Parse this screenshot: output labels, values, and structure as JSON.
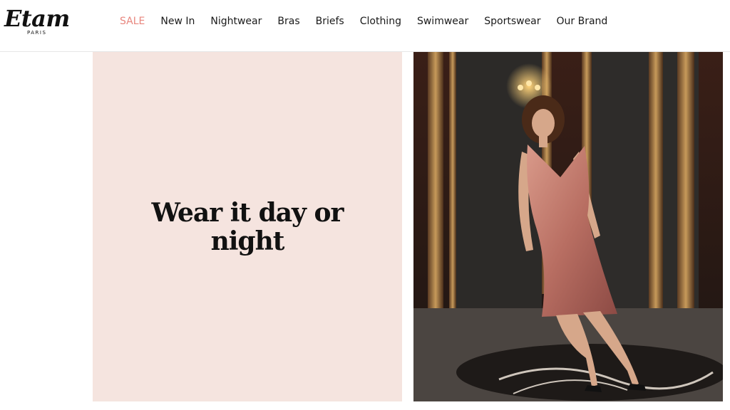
{
  "header": {
    "logo": {
      "word": "Etam",
      "sub": "PARIS"
    },
    "nav": [
      {
        "label": "SALE",
        "highlight": true
      },
      {
        "label": "New In"
      },
      {
        "label": "Nightwear"
      },
      {
        "label": "Bras"
      },
      {
        "label": "Briefs"
      },
      {
        "label": "Clothing"
      },
      {
        "label": "Swimwear"
      },
      {
        "label": "Sportswear"
      },
      {
        "label": "Our Brand"
      }
    ]
  },
  "promo": {
    "heading": "Wear it day or night",
    "background_color": "#f5e4df"
  },
  "hero": {
    "image_description": "model-in-pink-satin-slip-dress"
  },
  "colors": {
    "sale": "#e8867e",
    "text": "#111111",
    "panel": "#f5e4df"
  }
}
